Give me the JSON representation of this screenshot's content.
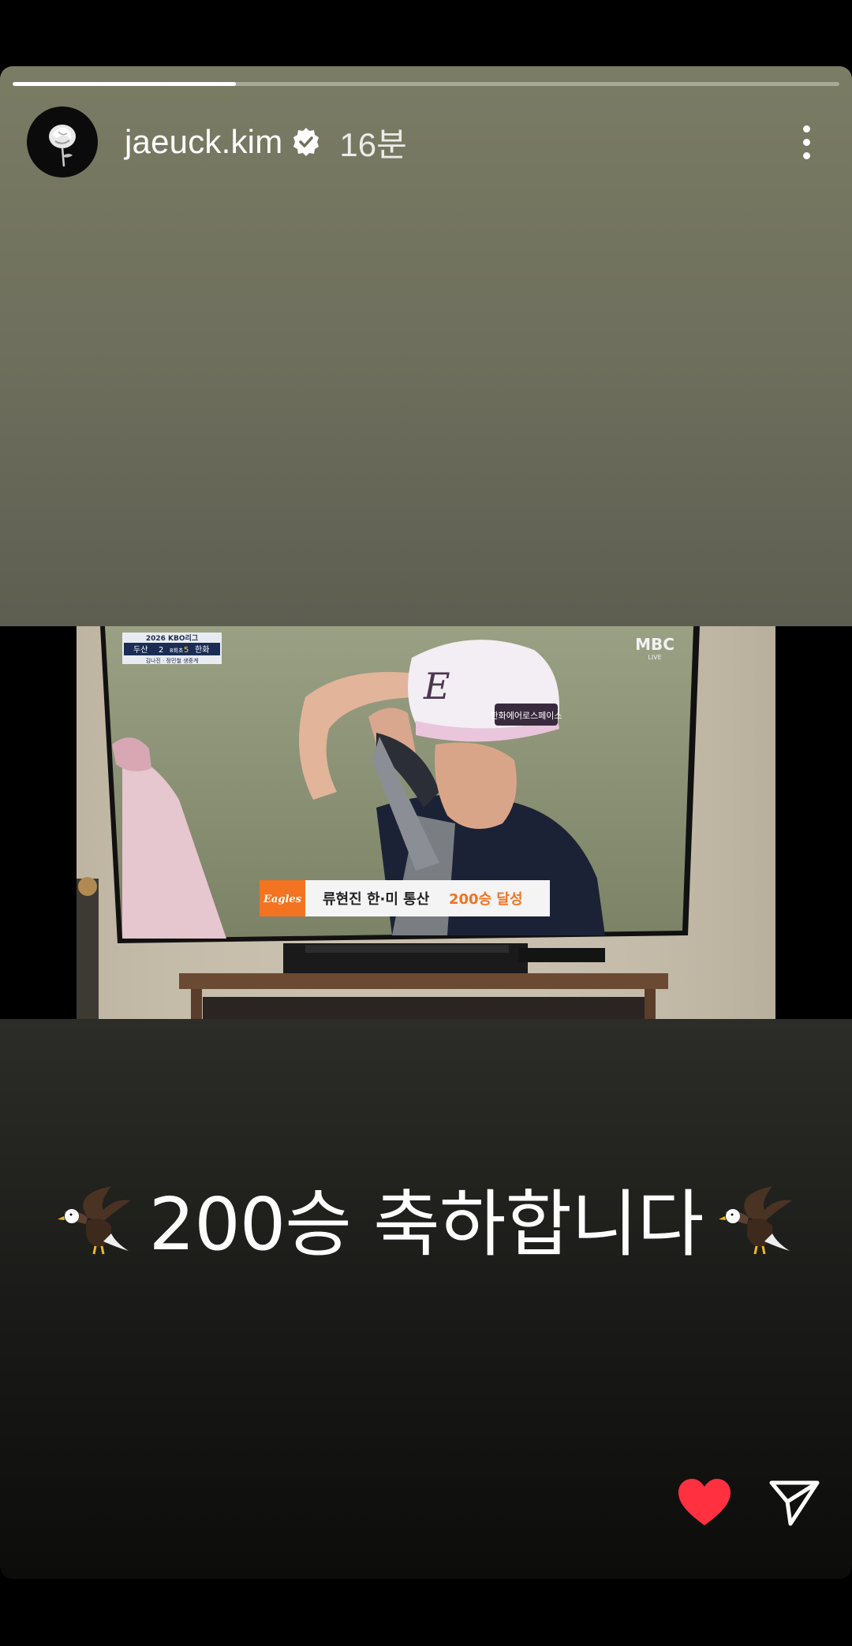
{
  "story": {
    "progress": 0.27,
    "username": "jaeuck.kim",
    "time_ago": "16분",
    "caption": "200승 축하합니다"
  },
  "photo": {
    "scoreboard_title": "2026 KBO리그",
    "team_home": "두산",
    "score_home": "2",
    "inning": "8회초",
    "score_away": "5",
    "team_away": "한화",
    "commentators": "김나진 · 정민철 생중계",
    "broadcaster": "MBC",
    "broadcaster_sub": "LIVE",
    "cap_patch": "한화에어로스페이스",
    "ticker_logo": "Eagles",
    "ticker_text": "류현진 한·미 통산",
    "ticker_highlight": "200승 달성"
  },
  "colors": {
    "like": "#ff3040",
    "ticker_orange": "#f37321"
  },
  "icons": {
    "avatar": "white-rose-icon",
    "verified": "verified-badge-icon",
    "more": "more-options-icon",
    "caption_left": "eagle-emoji",
    "caption_right": "eagle-emoji",
    "like": "heart-icon",
    "share": "send-icon"
  }
}
